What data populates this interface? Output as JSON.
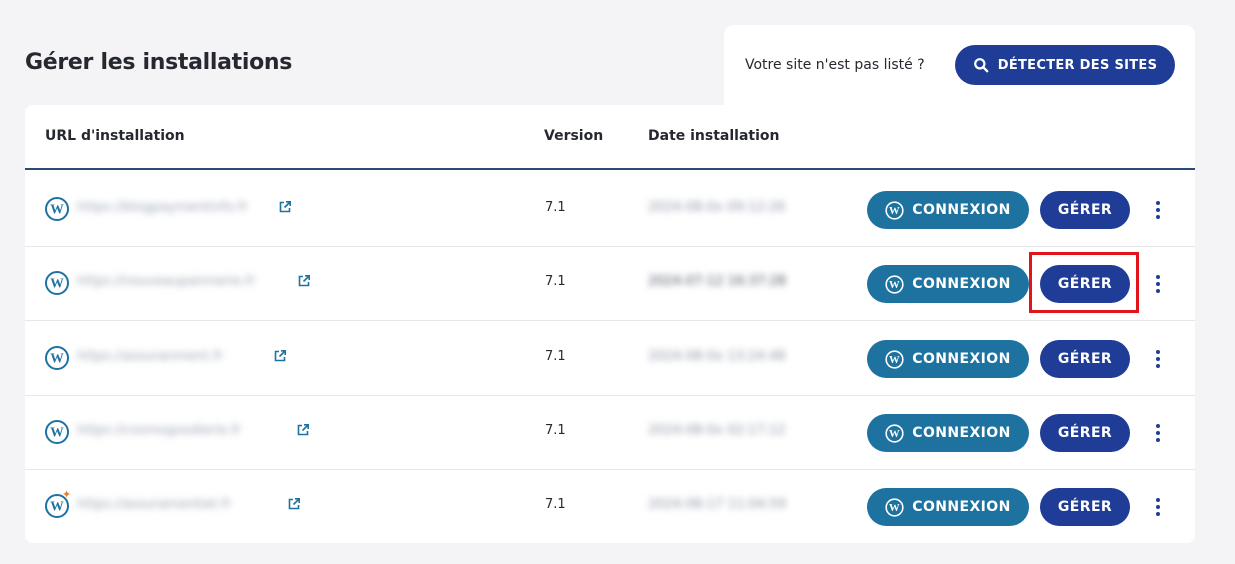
{
  "page": {
    "title": "Gérer les installations"
  },
  "detect": {
    "question": "Votre site n'est pas listé ?",
    "button_label": "DÉTECTER DES SITES"
  },
  "table": {
    "headers": {
      "url": "URL d'installation",
      "version": "Version",
      "date": "Date installation"
    },
    "rows": [
      {
        "url": "https://blogpaymentinfo.fr",
        "version": "7.1",
        "date": "2024-08-0x 09:12:26",
        "connexion_label": "CONNEXION",
        "gerer_label": "GÉRER"
      },
      {
        "url": "https://nouveaupainnerie.fr",
        "version": "7.1",
        "date": "2024-07-12 16:37:28",
        "connexion_label": "CONNEXION",
        "gerer_label": "GÉRER"
      },
      {
        "url": "https://assuranment.fr",
        "version": "7.1",
        "date": "2024-08-0x 13:24:48",
        "connexion_label": "CONNEXION",
        "gerer_label": "GÉRER"
      },
      {
        "url": "https://cosmogoodierie.fr",
        "version": "7.1",
        "date": "2024-08-0x 02:17:12",
        "connexion_label": "CONNEXION",
        "gerer_label": "GÉRER"
      },
      {
        "url": "https://assuramentiet.fr",
        "version": "7.1",
        "date": "2024-08-17 11:04:59",
        "connexion_label": "CONNEXION",
        "gerer_label": "GÉRER"
      }
    ]
  },
  "icons": {
    "row_logo": "wordpress-icon",
    "link": "external-link-icon",
    "menu": "more-vertical-icon",
    "search": "search-icon",
    "spark": "sparkle-icon"
  },
  "colors": {
    "primary": "#1f3d96",
    "connexion": "#1e72a0",
    "highlight": "#e0141a",
    "header_rule": "#2a4a78"
  }
}
